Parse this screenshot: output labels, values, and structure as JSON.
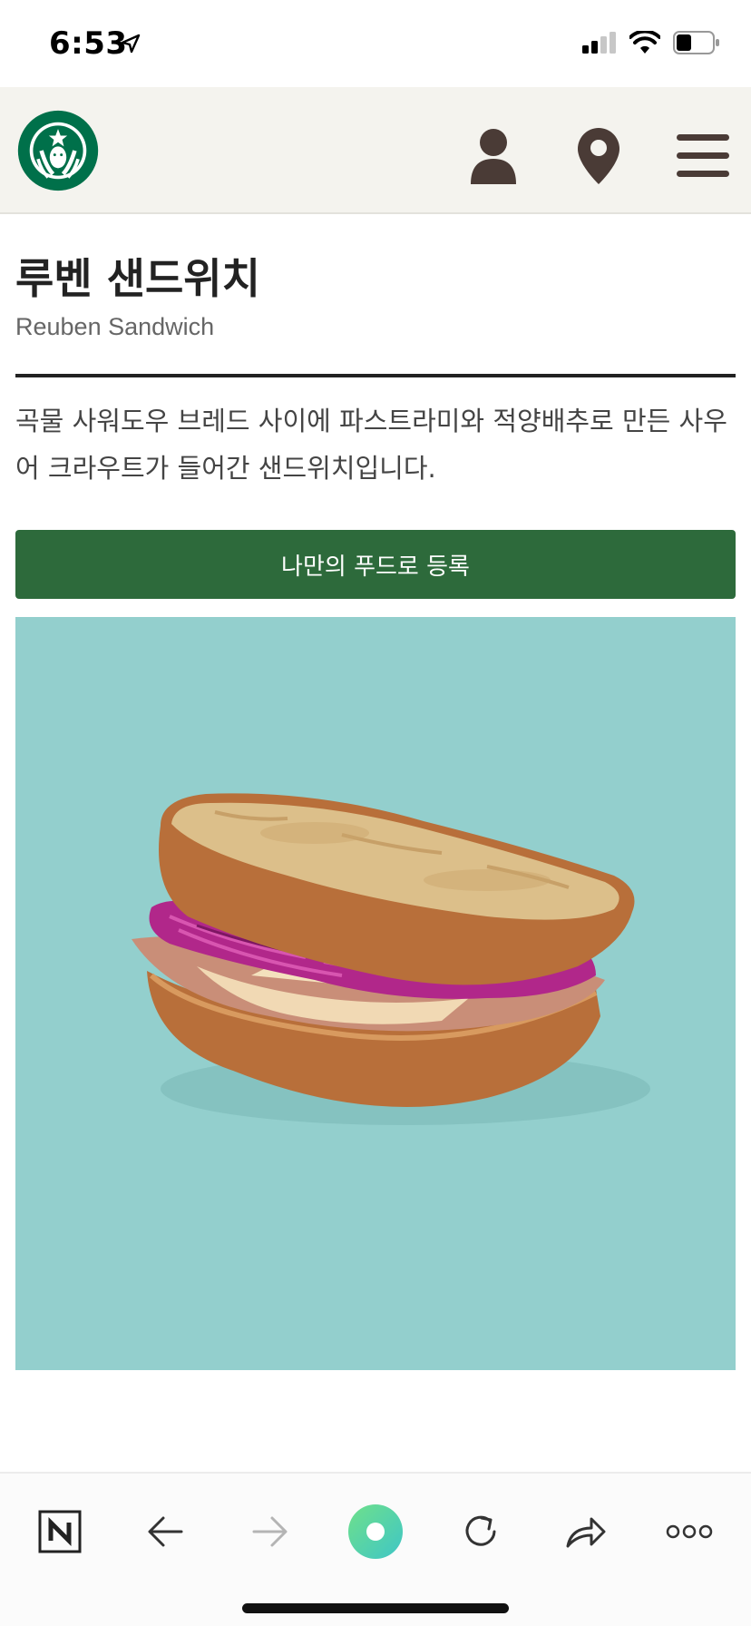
{
  "status_bar": {
    "time": "6:53",
    "icons": [
      "location-arrow-icon",
      "cellular-signal-icon",
      "wifi-icon",
      "battery-icon"
    ]
  },
  "header": {
    "logo": "starbucks-siren-logo",
    "icons": [
      "user-icon",
      "location-pin-icon",
      "hamburger-menu-icon"
    ],
    "background": "#f4f3ee"
  },
  "product": {
    "name_ko": "루벤 샌드위치",
    "name_en": "Reuben Sandwich",
    "description": "곡물 사워도우 브레드 사이에 파스트라미와 적양배추로 만든 사우어 크라우트가 들어간 샌드위치입니다.",
    "favorite_button_label": "나만의 푸드로 등록",
    "image_alt": "Reuben sandwich with pastrami and red cabbage sauerkraut",
    "image_background": "#93cfcd"
  },
  "browser_toolbar": {
    "icons": [
      "naver-n-icon",
      "back-arrow-icon",
      "forward-arrow-icon",
      "green-dot-icon",
      "refresh-icon",
      "share-icon",
      "more-icon"
    ]
  },
  "colors": {
    "brand_green": "#00704a",
    "button_green": "#2d6a3b",
    "divider": "#222222"
  }
}
